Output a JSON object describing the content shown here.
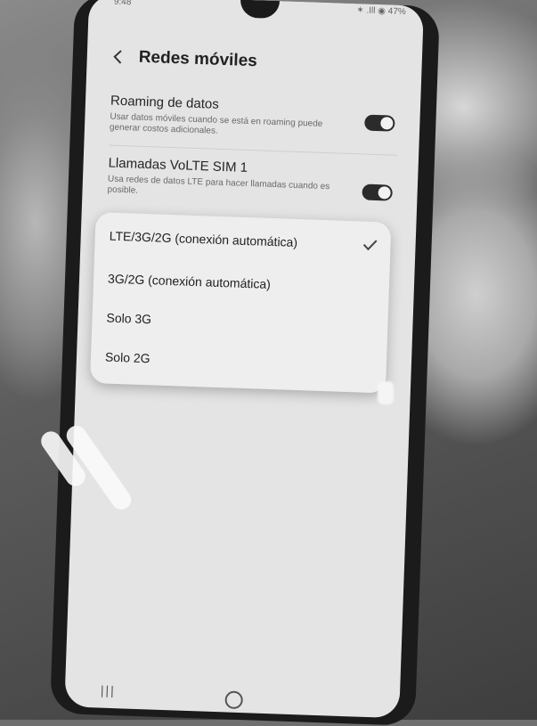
{
  "status_bar": {
    "time": "9:48",
    "indicators": "✶ .Ill ◉ 47%"
  },
  "header": {
    "title": "Redes móviles",
    "back_icon": "chevron-left-icon"
  },
  "settings": [
    {
      "title": "Roaming de datos",
      "description": "Usar datos móviles cuando se está en roaming puede generar costos adicionales.",
      "toggle_on": true
    },
    {
      "title": "Llamadas VoLTE SIM 1",
      "description": "Usa redes de datos LTE para hacer llamadas cuando es posible.",
      "toggle_on": true
    }
  ],
  "network_mode_options": [
    {
      "label": "LTE/3G/2G (conexión automática)",
      "selected": true
    },
    {
      "label": "3G/2G (conexión automática)",
      "selected": false
    },
    {
      "label": "Solo 3G",
      "selected": false
    },
    {
      "label": "Solo 2G",
      "selected": false
    }
  ],
  "nav_bar": {
    "recents": "|||",
    "home_icon": "home-circle-icon"
  }
}
